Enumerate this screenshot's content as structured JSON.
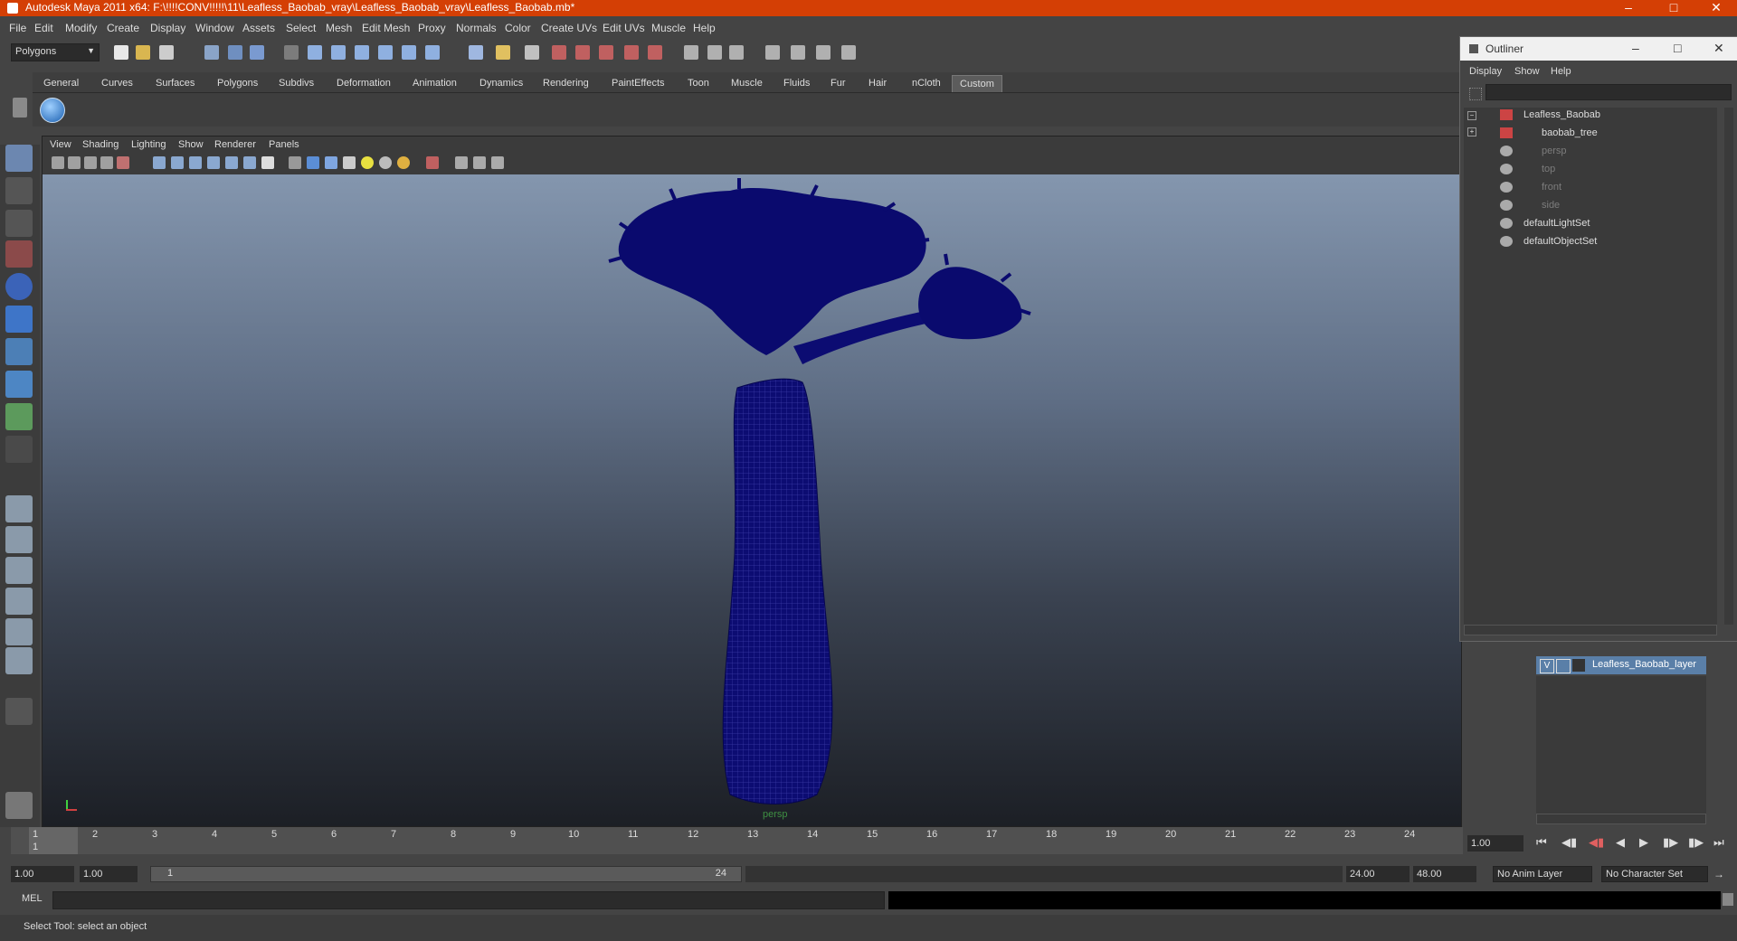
{
  "window": {
    "title": "Autodesk Maya 2011 x64: F:\\!!!!CONV!!!!!\\11\\Leafless_Baobab_vray\\Leafless_Baobab_vray\\Leafless_Baobab.mb*"
  },
  "menubar": [
    "File",
    "Edit",
    "Modify",
    "Create",
    "Display",
    "Window",
    "Assets",
    "Select",
    "Mesh",
    "Edit Mesh",
    "Proxy",
    "Normals",
    "Color",
    "Create UVs",
    "Edit UVs",
    "Muscle",
    "Help"
  ],
  "statusline": {
    "menuset": "Polygons"
  },
  "shelf": {
    "tabs": [
      "General",
      "Curves",
      "Surfaces",
      "Polygons",
      "Subdivs",
      "Deformation",
      "Animation",
      "Dynamics",
      "Rendering",
      "PaintEffects",
      "Toon",
      "Muscle",
      "Fluids",
      "Fur",
      "Hair",
      "nCloth",
      "Custom"
    ],
    "active": "Custom"
  },
  "panel": {
    "menus": [
      "View",
      "Shading",
      "Lighting",
      "Show",
      "Renderer",
      "Panels"
    ],
    "camera_label": "persp"
  },
  "timeline": {
    "ticks": [
      "1",
      "2",
      "3",
      "4",
      "5",
      "6",
      "7",
      "8",
      "9",
      "10",
      "11",
      "12",
      "13",
      "14",
      "15",
      "16",
      "17",
      "18",
      "19",
      "20",
      "21",
      "22",
      "23",
      "24"
    ],
    "current_frame": "1.00"
  },
  "range": {
    "start": "1.00",
    "start2": "1.00",
    "slider_start": "1",
    "slider_end": "24",
    "end": "24.00",
    "end2": "48.00",
    "anim_layer": "No Anim Layer",
    "char_set": "No Character Set"
  },
  "cmdline": {
    "label": "MEL"
  },
  "helpline": {
    "text": "Select Tool: select an object"
  },
  "outliner": {
    "title": "Outliner",
    "menus": [
      "Display",
      "Show",
      "Help"
    ],
    "items": [
      {
        "label": "Leafless_Baobab",
        "color": "#dddddd"
      },
      {
        "label": "baobab_tree",
        "color": "#dddddd"
      },
      {
        "label": "persp",
        "color": "#7c7c7c"
      },
      {
        "label": "top",
        "color": "#7c7c7c"
      },
      {
        "label": "front",
        "color": "#7c7c7c"
      },
      {
        "label": "side",
        "color": "#7c7c7c"
      },
      {
        "label": "defaultLightSet",
        "color": "#dddddd"
      },
      {
        "label": "defaultObjectSet",
        "color": "#dddddd"
      }
    ]
  },
  "layers": {
    "row": {
      "visible": "V",
      "name": "Leafless_Baobab_layer"
    }
  },
  "colors": {
    "title_bar": "#d43f05",
    "wireframe": "#0a0a6e",
    "layer_highlight": "#5a7fa8"
  }
}
